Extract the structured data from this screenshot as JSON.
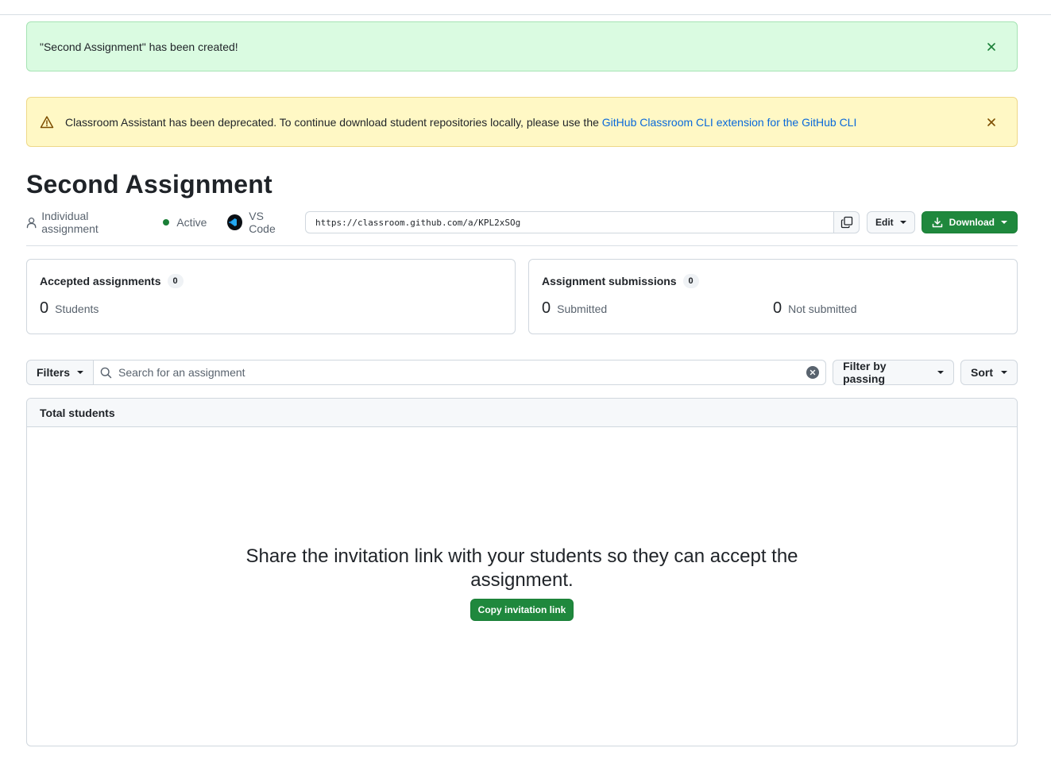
{
  "flash_success": {
    "message": "\"Second Assignment\" has been created!"
  },
  "flash_warning": {
    "message": "Classroom Assistant has been deprecated. To continue download student repositories locally, please use the ",
    "link_text": "GitHub Classroom CLI extension for the GitHub CLI"
  },
  "assignment": {
    "title": "Second Assignment",
    "type": "Individual assignment",
    "status": "Active",
    "editor": "VS Code",
    "invite_url": "https://classroom.github.com/a/KPL2xSOg"
  },
  "actions": {
    "edit_label": "Edit",
    "download_label": "Download"
  },
  "stats": {
    "accepted": {
      "title": "Accepted assignments",
      "count": "0",
      "students_num": "0",
      "students_label": "Students"
    },
    "submissions": {
      "title": "Assignment submissions",
      "count": "0",
      "submitted_num": "0",
      "submitted_label": "Submitted",
      "not_submitted_num": "0",
      "not_submitted_label": "Not submitted"
    }
  },
  "toolbar": {
    "filters_label": "Filters",
    "search_placeholder": "Search for an assignment",
    "filter_passing_label": "Filter by passing",
    "sort_label": "Sort"
  },
  "table": {
    "header": "Total students",
    "empty_message": "Share the invitation link with your students so they can accept the assignment.",
    "copy_link_label": "Copy invitation link"
  },
  "colors": {
    "success_bg": "#dafbe1",
    "warning_bg": "#fff8c5",
    "primary_green": "#1f883d",
    "link_blue": "#0969da",
    "active_dot": "#1a7f37"
  }
}
